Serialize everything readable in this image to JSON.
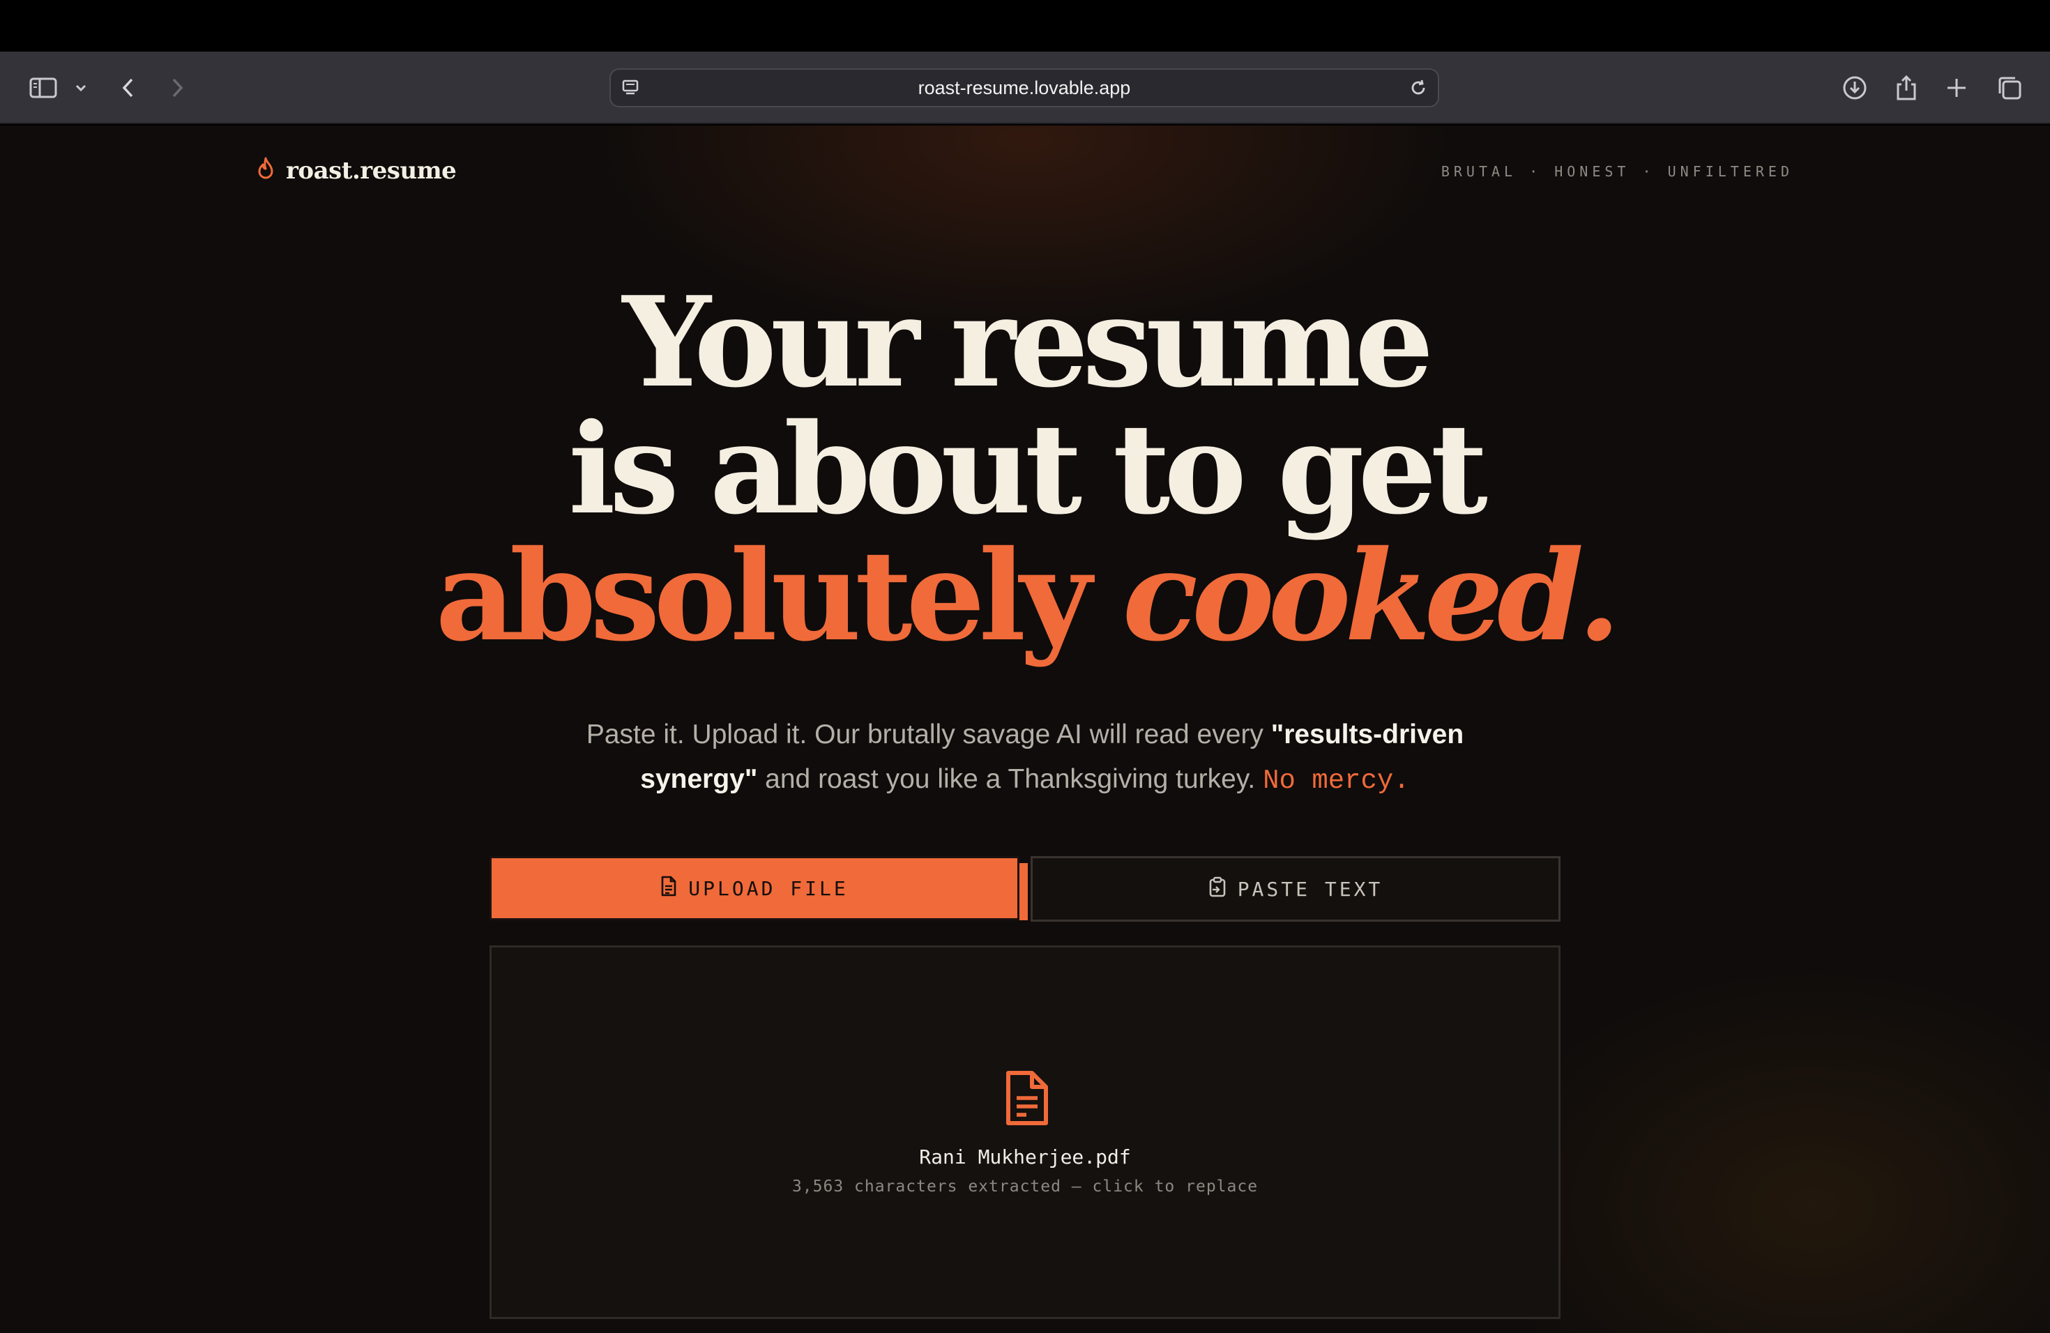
{
  "browser": {
    "url": "roast-resume.lovable.app"
  },
  "header": {
    "logo_text": "roast.resume",
    "tagline": "BRUTAL · HONEST · UNFILTERED"
  },
  "hero": {
    "line1": "Your resume",
    "line2": "is about to get",
    "line3_a": "absolutely",
    "line3_b": "cooked."
  },
  "subtext": {
    "part1": "Paste it. Upload it. Our brutally savage AI will read every ",
    "highlight": "\"results-driven synergy\"",
    "part2": " and roast you like a Thanksgiving turkey. ",
    "mono": "No mercy."
  },
  "tabs": {
    "upload_label": "UPLOAD FILE",
    "paste_label": "PASTE TEXT"
  },
  "dropzone": {
    "file_name": "Rani Mukherjee.pdf",
    "file_meta": "3,563 characters extracted — click to replace"
  },
  "colors": {
    "accent": "#f06a3a",
    "cream": "#f5efe2",
    "background": "#0f0c0b"
  },
  "icons": {
    "logo": "flame-icon",
    "upload": "file-text-icon",
    "paste": "clipboard-icon",
    "dropzone": "file-text-icon"
  }
}
